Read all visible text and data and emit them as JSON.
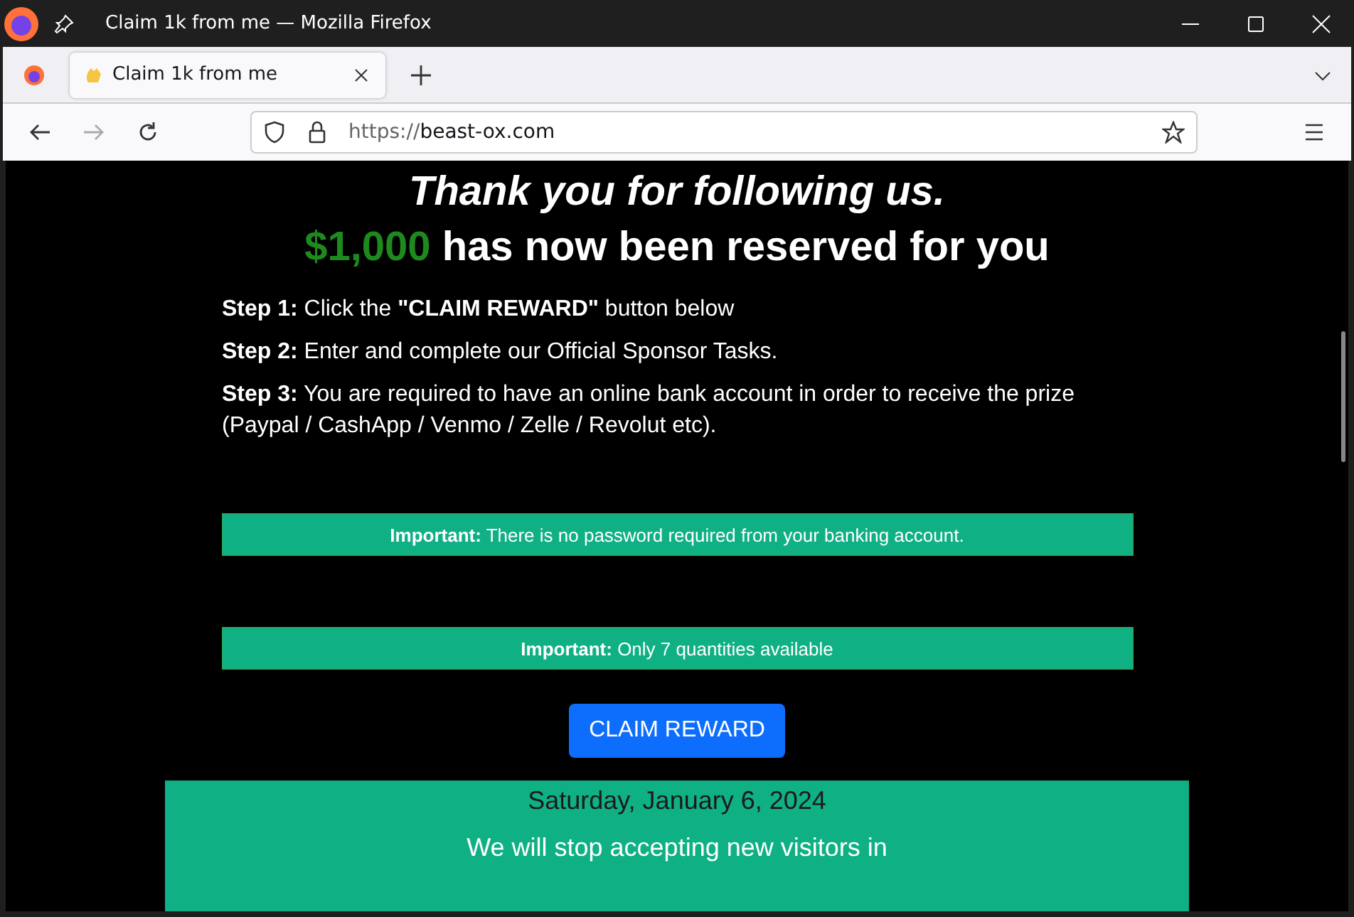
{
  "window": {
    "title": "Claim 1k from me — Mozilla Firefox"
  },
  "tabs": [
    {
      "label": "Claim 1k from me",
      "selected": true
    }
  ],
  "address_bar": {
    "scheme": "https://",
    "host": "beast-ox.com"
  },
  "page": {
    "headline": "Thank you for following us.",
    "amount": "$1,000",
    "subheadline": "has now been reserved for you",
    "steps": [
      "**Step 1:** Click the **\"CLAIM REWARD\"** button below",
      "**Step 2:** Enter and complete our Official Sponsor Tasks.",
      "**Step 3:** You are required to have an online bank account in order to receive the prize (Paypal / CashApp / Venmo / Zelle / Revolut etc)."
    ],
    "notices": [
      "**Important:** There is no password required from your banking account.",
      "**Important:** Only 7 quantities available"
    ],
    "button": "CLAIM REWARD",
    "countdown": {
      "date": "Saturday, January 6, 2024",
      "message": "We will stop accepting new visitors in"
    }
  }
}
